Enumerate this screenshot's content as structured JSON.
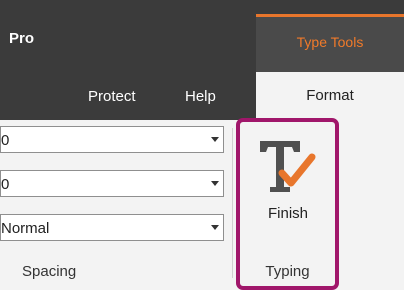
{
  "window": {
    "title": "Pro"
  },
  "contextual_tab": {
    "label": "Type Tools",
    "accent_color": "#f07a2a"
  },
  "ribbon_tabs": [
    {
      "label": "Protect"
    },
    {
      "label": "Help"
    }
  ],
  "active_tab": {
    "label": "Format"
  },
  "spacing_group": {
    "dropdowns": [
      {
        "value": "0"
      },
      {
        "value": "0"
      },
      {
        "value": "Normal"
      }
    ],
    "label": "Spacing"
  },
  "typing_group": {
    "finish_button": {
      "label": "Finish",
      "icon": "type-finish-icon"
    },
    "label": "Typing",
    "highlight_color": "#a0166a"
  }
}
